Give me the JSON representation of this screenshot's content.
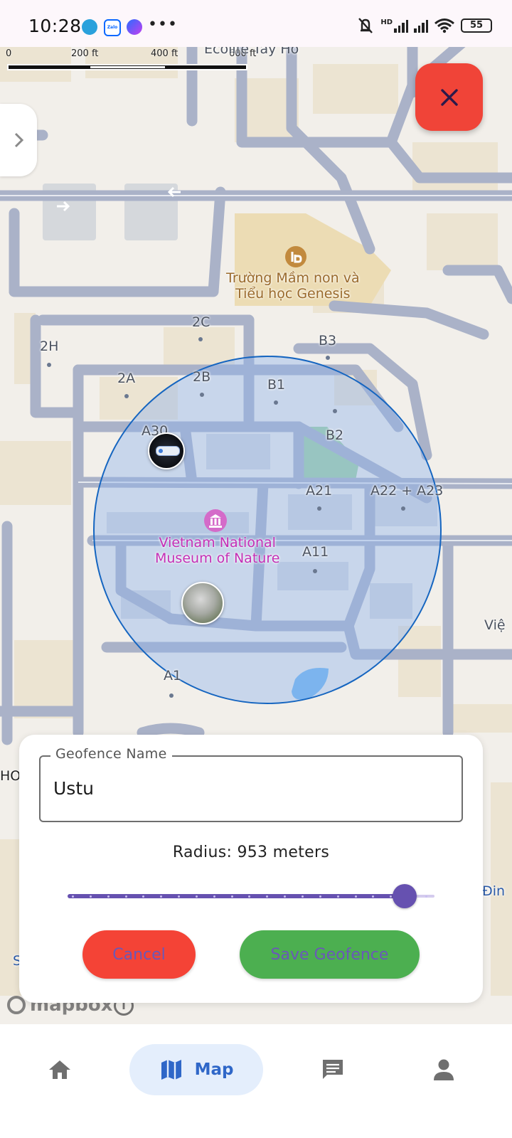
{
  "status_bar": {
    "time": "10:28",
    "app_icons": [
      "telegram-icon",
      "zalo-icon",
      "messenger-icon"
    ],
    "zalo_text": "Zalo",
    "more": "•••",
    "network_label": "HD",
    "battery": "55"
  },
  "map": {
    "scale": {
      "labels": [
        "0",
        "200 ft",
        "400 ft",
        "600 ft"
      ]
    },
    "labels": {
      "ecolife": "Ecolife Tây Hồ",
      "school": "Trường Mầm non và\nTiểu học Genesis",
      "museum": "Vietnam National\nMuseum of Nature",
      "b_2c": "2C",
      "b_2h": "2H",
      "b_2a": "2A",
      "b_2b": "2B",
      "b_b1": "B1",
      "b_b3": "B3",
      "b_b2": "B2",
      "b_a30": "A30",
      "b_a21": "A21",
      "b_a22": "A22 + A23",
      "b_a11": "A11",
      "b_a1": "A1",
      "edge_vie": "Việ",
      "edge_dinh": "Đin",
      "edge_ho": "HO",
      "edge_s": "S"
    },
    "attribution": "mapbox",
    "info": "i",
    "geofence_color": "#1565c0",
    "geofence_fill": "#8fb3ec"
  },
  "geofence_form": {
    "name_label": "Geofence Name",
    "name_value": "Ustu",
    "radius_text": "Radius: 953 meters",
    "radius_value": 953,
    "slider_fraction": 0.955,
    "cancel_label": "Cancel",
    "save_label": "Save Geofence"
  },
  "colors": {
    "accent_purple": "#6651b0",
    "cancel_red": "#f44336",
    "save_green": "#4caf50",
    "close_red": "#f04438",
    "nav_active_bg": "#e4eefc",
    "nav_active_text": "#2f67c8"
  },
  "bottom_nav": {
    "items": [
      {
        "icon": "home-icon",
        "label": ""
      },
      {
        "icon": "map-icon",
        "label": "Map",
        "active": true
      },
      {
        "icon": "chat-icon",
        "label": ""
      },
      {
        "icon": "person-icon",
        "label": ""
      }
    ]
  }
}
